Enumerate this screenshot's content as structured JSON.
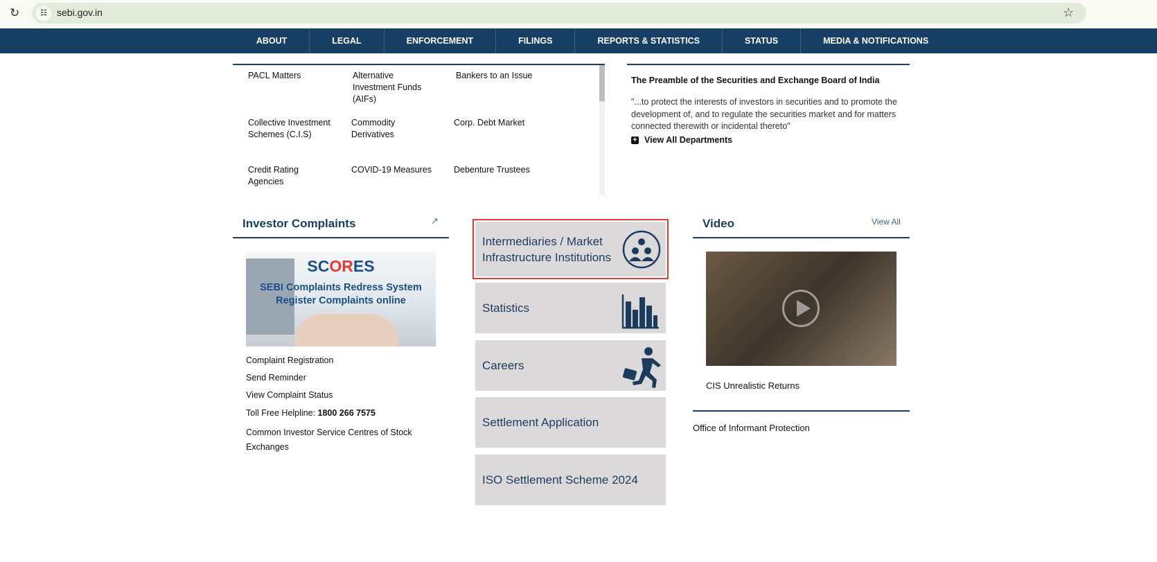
{
  "browser": {
    "url": "sebi.gov.in"
  },
  "nav": [
    "ABOUT",
    "LEGAL",
    "ENFORCEMENT",
    "FILINGS",
    "REPORTS & STATISTICS",
    "STATUS",
    "MEDIA & NOTIFICATIONS"
  ],
  "departments": [
    [
      "PACL Matters",
      "Alternative Investment Funds (AIFs)",
      "Bankers to an Issue"
    ],
    [
      "Collective Investment Schemes (C.I.S)",
      "Commodity Derivatives",
      "Corp. Debt Market"
    ],
    [
      "Credit Rating Agencies",
      "COVID-19 Measures",
      "Debenture Trustees"
    ]
  ],
  "preamble": {
    "title": "The Preamble of the Securities and Exchange Board of India",
    "text": "\"...to protect the interests of investors in securities and to promote the development of, and to regulate the securities market and for matters connected therewith or incidental thereto\"",
    "view_all": "View All Departments"
  },
  "complaints": {
    "title": "Investor Complaints",
    "banner_logo": "SCORES",
    "banner_line1": "SEBI Complaints Redress System",
    "banner_line2": "Register Complaints online",
    "links": [
      "Complaint Registration",
      "Send Reminder",
      "View Complaint Status"
    ],
    "helpline_label": "Toll Free Helpline: ",
    "helpline_number": "1800 266 7575",
    "csc": "Common Investor Service Centres of Stock Exchanges"
  },
  "tiles": [
    "Intermediaries / Market Infrastructure Institutions",
    "Statistics",
    "Careers",
    "Settlement Application",
    "ISO Settlement Scheme 2024"
  ],
  "video": {
    "title": "Video",
    "view_all": "View All",
    "caption": "CIS Unrealistic Returns"
  },
  "informant": "Office of Informant Protection",
  "colors": {
    "nav": "#173f64",
    "tile": "#dcd9da",
    "highlight": "#e53935"
  }
}
